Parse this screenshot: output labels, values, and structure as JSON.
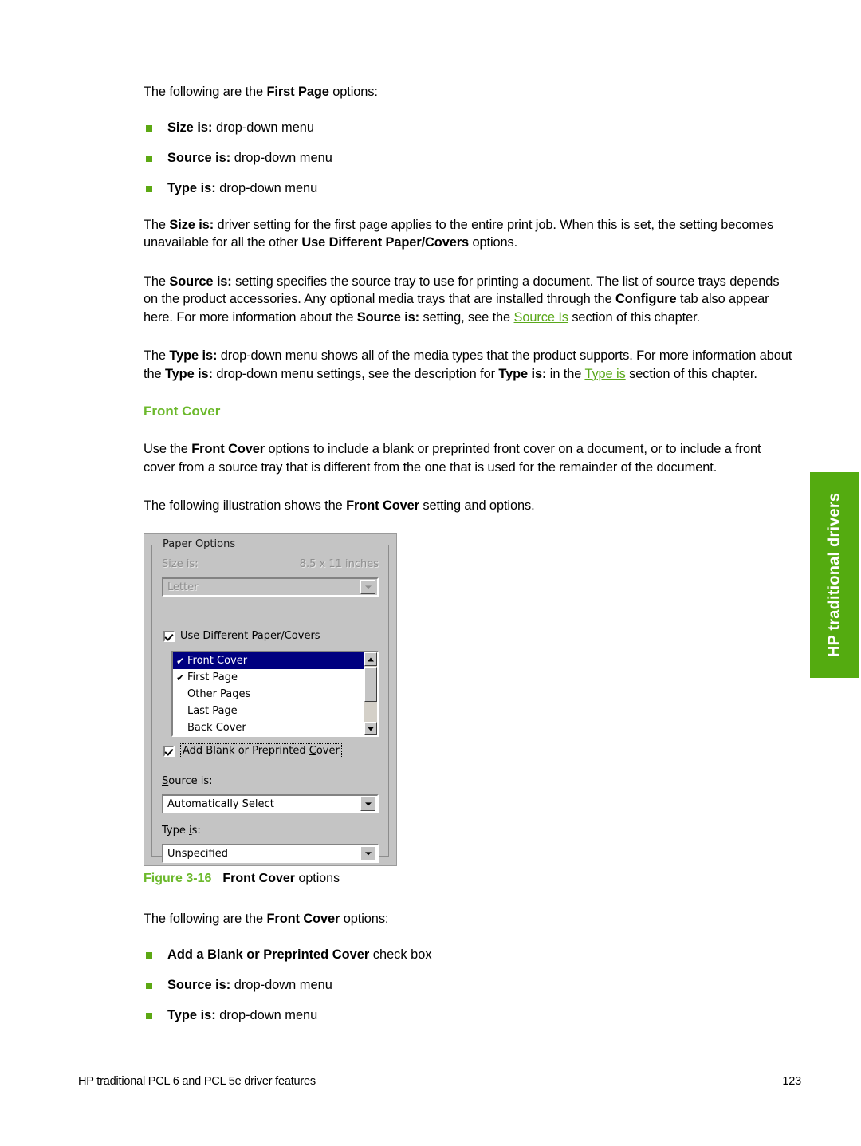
{
  "document": {
    "footer_left": "HP traditional PCL 6 and PCL 5e driver features",
    "page_number": "123",
    "side_tab_label": "HP traditional drivers",
    "accent_green": "#6cb92c",
    "bullet_green": "#5ca813",
    "tab_green": "#54ab10",
    "link_green": "#5aa81a"
  },
  "sections": {
    "intro_first_page": {
      "lead": {
        "pre": "The following are the ",
        "bold": "First Page",
        "post": " options:"
      },
      "bullets": [
        {
          "bold": "Size is:",
          "rest": " drop-down menu"
        },
        {
          "bold": "Source is:",
          "rest": " drop-down menu"
        },
        {
          "bold": "Type is:",
          "rest": " drop-down menu"
        }
      ]
    },
    "para_size_is": {
      "p1": "The ",
      "b1": "Size is:",
      "p2": " driver setting for the first page applies to the entire print job. When this is set, the setting becomes unavailable for all the other ",
      "b2": "Use Different Paper/Covers",
      "p3": " options."
    },
    "para_source_is": {
      "p1": "The ",
      "b1": "Source is:",
      "p2": " setting specifies the source tray to use for printing a document. The list of source trays depends on the product accessories. Any optional media trays that are installed through the ",
      "b2": "Configure",
      "p3": " tab also appear here. For more information about the ",
      "b3": "Source is:",
      "p4": " setting, see the ",
      "link": "Source Is",
      "p5": " section of this chapter."
    },
    "para_type_is": {
      "p1": "The ",
      "b1": "Type is:",
      "p2": " drop-down menu shows all of the media types that the product supports. For more information about the ",
      "b2": "Type is:",
      "p3": " drop-down menu settings, see the description for ",
      "b3": "Type is:",
      "p4": " in the ",
      "link": "Type is",
      "p5": " section of this chapter."
    },
    "front_cover": {
      "heading": "Front Cover",
      "para1": {
        "p1": "Use the ",
        "b1": "Front Cover",
        "p2": " options to include a blank or preprinted front cover on a document, or to include a front cover from a source tray that is different from the one that is used for the remainder of the document."
      },
      "para2": {
        "p1": "The following illustration shows the ",
        "b1": "Front Cover",
        "p2": " setting and options."
      },
      "caption": {
        "number": "Figure 3-16",
        "bold": "Front Cover",
        "rest": " options"
      },
      "options_lead": {
        "pre": "The following are the ",
        "bold": "Front Cover",
        "post": " options:"
      },
      "options_bullets": [
        {
          "bold": "Add a Blank or Preprinted Cover",
          "rest": " check box"
        },
        {
          "bold": "Source is:",
          "rest": " drop-down menu"
        },
        {
          "bold": "Type is:",
          "rest": " drop-down menu"
        }
      ]
    }
  },
  "dialog": {
    "groupbox_title": "Paper Options",
    "size_is_label": "Size is:",
    "size_dimensions": "8.5 x 11 inches",
    "size_value": "Letter",
    "use_different_label": "Use Different Paper/Covers",
    "use_different_checked": true,
    "list_items": [
      {
        "label": "Front Cover",
        "checked": true,
        "selected": true
      },
      {
        "label": "First Page",
        "checked": true,
        "selected": false
      },
      {
        "label": "Other Pages",
        "checked": false,
        "selected": false
      },
      {
        "label": "Last Page",
        "checked": false,
        "selected": false
      },
      {
        "label": "Back Cover",
        "checked": false,
        "selected": false
      }
    ],
    "add_blank_label": "Add Blank or Preprinted Cover",
    "add_blank_checked": true,
    "source_is_label": "Source is:",
    "source_is_value": "Automatically Select",
    "type_is_label": "Type is:",
    "type_is_value": "Unspecified",
    "checkmark_glyph": "✔",
    "selection_color": "#000080",
    "face_color": "#c4c4c4"
  }
}
